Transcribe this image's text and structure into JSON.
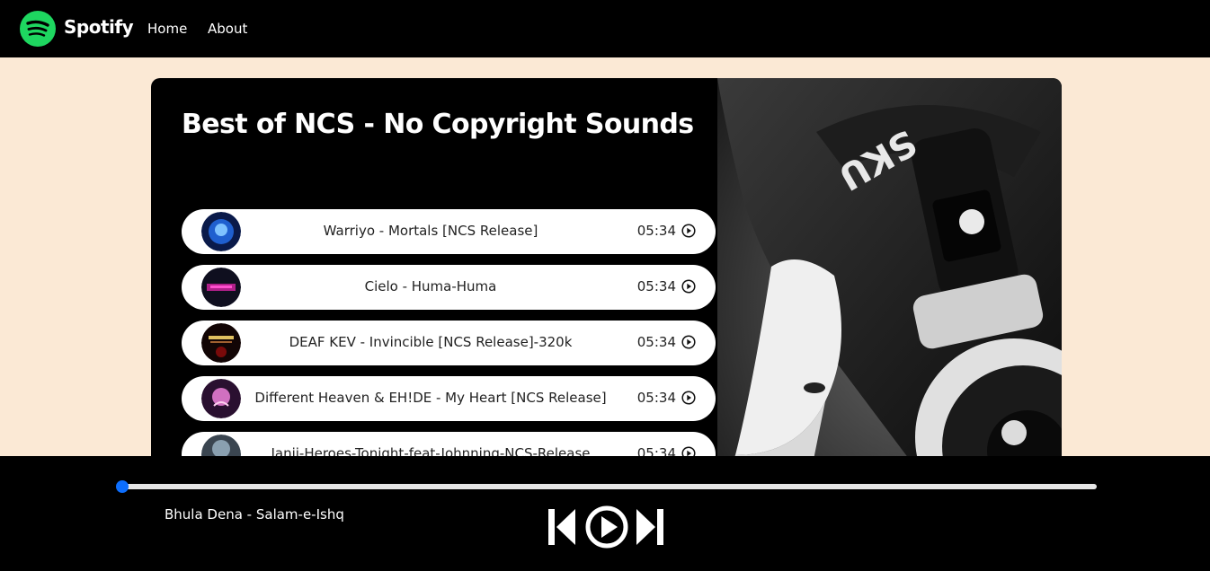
{
  "navbar": {
    "brand": "Spotify",
    "links": [
      "Home",
      "About"
    ],
    "brand_color": "#1ed760"
  },
  "playlist": {
    "title": "Best of NCS - No Copyright Sounds",
    "songs": [
      {
        "name": "Warriyo - Mortals [NCS Release]",
        "duration": "05:34"
      },
      {
        "name": "Cielo - Huma-Huma",
        "duration": "05:34"
      },
      {
        "name": "DEAF KEV - Invincible [NCS Release]-320k",
        "duration": "05:34"
      },
      {
        "name": "Different Heaven & EH!DE - My Heart [NCS Release]",
        "duration": "05:34"
      },
      {
        "name": "Janji-Heroes-Tonight-feat-Johnning-NCS-Release",
        "duration": "05:34"
      }
    ]
  },
  "player": {
    "now_playing": "Bhula Dena - Salam-e-Ishq",
    "progress": 0,
    "accent_color": "#0d6efd",
    "controls": [
      "previous-icon",
      "play-icon",
      "next-icon"
    ]
  }
}
